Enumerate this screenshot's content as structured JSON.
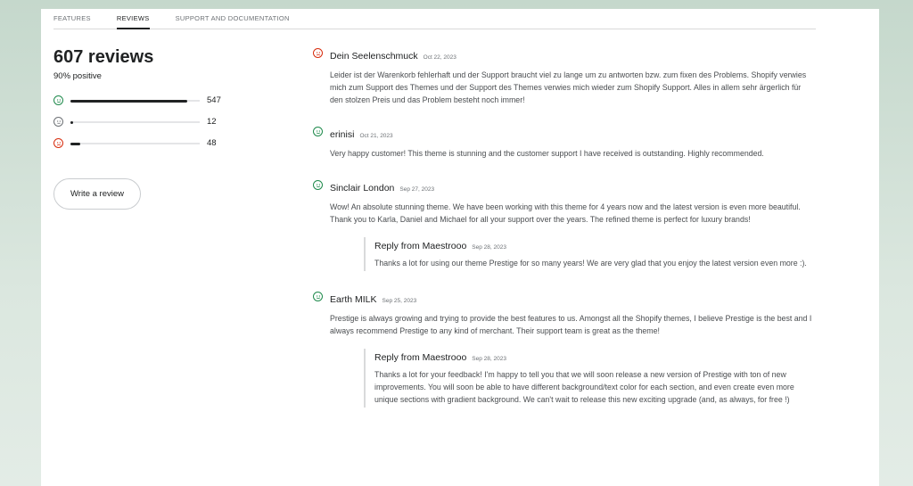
{
  "tabs": [
    {
      "label": "FEATURES"
    },
    {
      "label": "REVIEWS"
    },
    {
      "label": "SUPPORT AND DOCUMENTATION"
    }
  ],
  "summary": {
    "count_label": "607 reviews",
    "positive_label": "90% positive",
    "rows": [
      {
        "sentiment": "positive",
        "icon": "smile-face-icon",
        "count": "547",
        "fraction": 0.9
      },
      {
        "sentiment": "neutral",
        "icon": "neutral-face-icon",
        "count": "12",
        "fraction": 0.02
      },
      {
        "sentiment": "negative",
        "icon": "frown-face-icon",
        "count": "48",
        "fraction": 0.079
      }
    ],
    "write_review_label": "Write a review"
  },
  "colors": {
    "positive": "#1f8a4c",
    "negative": "#d72c0d",
    "neutral": "#6d7175"
  },
  "reviews": [
    {
      "author": "Dein Seelenschmuck",
      "date": "Oct 22, 2023",
      "sentiment": "negative",
      "text": "Leider ist der Warenkorb fehlerhaft und der Support braucht viel zu lange um zu antworten bzw. zum fixen des Problems. Shopify verwies mich zum Support des Themes und der Support des Themes verwies mich wieder zum Shopify Support. Alles in allem sehr ärgerlich für den stolzen Preis und das Problem besteht noch immer!"
    },
    {
      "author": "erinisi",
      "date": "Oct 21, 2023",
      "sentiment": "positive",
      "text": "Very happy customer! This theme is stunning and the customer support I have received is outstanding. Highly recommended."
    },
    {
      "author": "Sinclair London",
      "date": "Sep 27, 2023",
      "sentiment": "positive",
      "text": "Wow! An absolute stunning theme. We have been working with this theme for 4 years now and the latest version is even more beautiful. Thank you to Karla, Daniel and Michael for all your support over the years. The refined theme is perfect for luxury brands!",
      "reply": {
        "author": "Reply from Maestrooo",
        "date": "Sep 28, 2023",
        "text": "Thanks a lot for using our theme Prestige for so many years! We are very glad that you enjoy the latest version even more :)."
      }
    },
    {
      "author": "Earth MILK",
      "date": "Sep 25, 2023",
      "sentiment": "positive",
      "text": "Prestige is always growing and trying to provide the best features to us. Amongst all the Shopify themes, I believe Prestige is the best and I always recommend Prestige to any kind of merchant. Their support team is great as the theme!",
      "reply": {
        "author": "Reply from Maestrooo",
        "date": "Sep 28, 2023",
        "text": "Thanks a lot for your feedback! I'm happy to tell you that we will soon release a new version of Prestige with ton of new improvements. You will soon be able to have different background/text color for each section, and even create even more unique sections with gradient background. We can't wait to release this new exciting upgrade (and, as always, for free !)"
      }
    }
  ]
}
